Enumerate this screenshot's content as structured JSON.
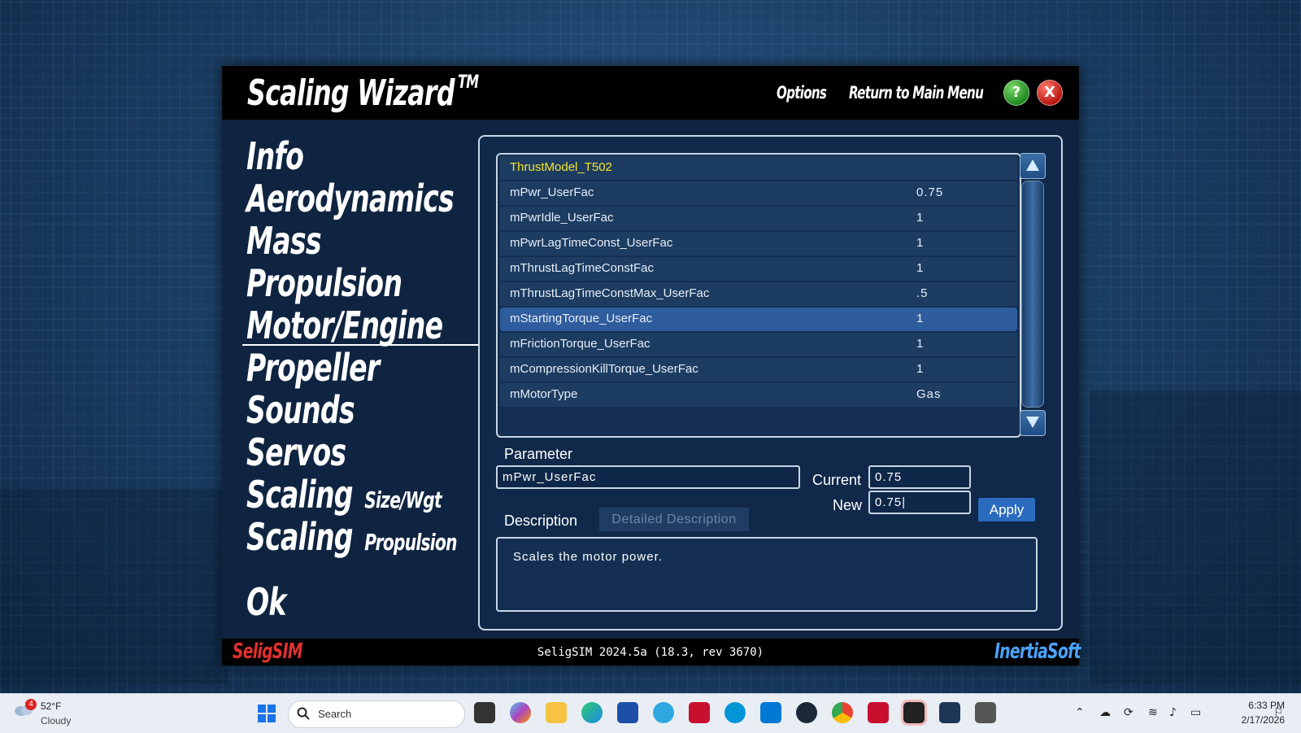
{
  "window": {
    "title": "Scaling Wizard",
    "trademark": "TM",
    "options_label": "Options",
    "main_menu_label": "Return to Main Menu",
    "help_label": "?",
    "close_label": "X"
  },
  "nav": {
    "items": [
      {
        "label": "Info"
      },
      {
        "label": "Aerodynamics"
      },
      {
        "label": "Mass"
      },
      {
        "label": "Propulsion"
      },
      {
        "label": "Motor/Engine",
        "selected": true
      },
      {
        "label": "Propeller"
      },
      {
        "label": "Sounds"
      },
      {
        "label": "Servos"
      },
      {
        "label": "Scaling",
        "sub": "Size/Wgt"
      },
      {
        "label": "Scaling",
        "sub": "Propulsion"
      }
    ],
    "ok_label": "Ok"
  },
  "table": {
    "header": "ThrustModel_T502",
    "rows": [
      {
        "name": "mPwr_UserFac",
        "value": "0.75"
      },
      {
        "name": "mPwrIdle_UserFac",
        "value": "1"
      },
      {
        "name": "mPwrLagTimeConst_UserFac",
        "value": "1"
      },
      {
        "name": "mThrustLagTimeConstFac",
        "value": "1"
      },
      {
        "name": "mThrustLagTimeConstMax_UserFac",
        "value": ".5"
      },
      {
        "name": "mStartingTorque_UserFac",
        "value": "1",
        "selected": true
      },
      {
        "name": "mFrictionTorque_UserFac",
        "value": "1"
      },
      {
        "name": "mCompressionKillTorque_UserFac",
        "value": "1"
      },
      {
        "name": "mMotorType",
        "value": "Gas"
      }
    ]
  },
  "editor": {
    "parameter_label": "Parameter",
    "parameter_value": "mPwr_UserFac",
    "current_label": "Current",
    "current_value": "0.75",
    "new_label": "New",
    "new_value": "0.75|",
    "apply_label": "Apply",
    "description_label": "Description",
    "detailed_description_label": "Detailed Description",
    "description_text": "Scales the motor power."
  },
  "statusbar": {
    "left_logo": "SeligSIM",
    "version": "SeligSIM 2024.5a (18.3, rev 3670)",
    "right_logo": "InertiaSoft"
  },
  "taskbar": {
    "weather_badge": "4",
    "weather_temp": "52°F",
    "weather_condition": "Cloudy",
    "search_placeholder": "Search",
    "clock_time": "6:33 PM",
    "clock_date": "2/17/2026",
    "icons": [
      "file-explorer",
      "copilot",
      "folder",
      "edge",
      "store",
      "teams",
      "mcafee",
      "hp",
      "vscode",
      "steam",
      "chrome",
      "mcafee-security",
      "terminal",
      "pt",
      "game"
    ]
  },
  "colors": {
    "header_row": "#f5e52a",
    "selected_row": "#2f5c9c",
    "apply_button": "#2b6bbd",
    "seligsim_logo": "#e23030",
    "inertiasoft_logo": "#4aa3ff"
  }
}
